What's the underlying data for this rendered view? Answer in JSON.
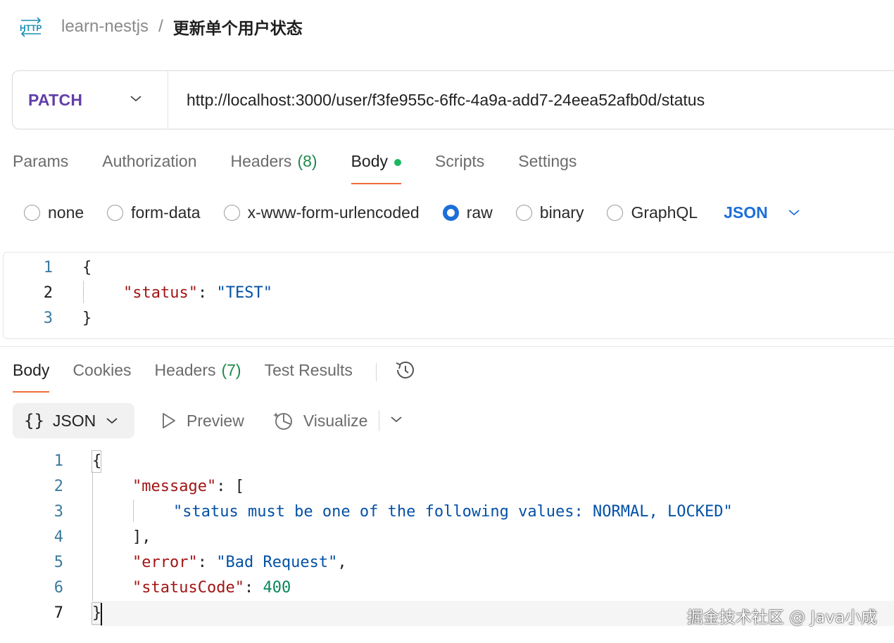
{
  "header": {
    "icon": "http-icon",
    "collection": "learn-nestjs",
    "separator": "/",
    "request_name": "更新单个用户状态"
  },
  "request": {
    "method": "PATCH",
    "url": "http://localhost:3000/user/f3fe955c-6ffc-4a9a-add7-24eea52afb0d/status"
  },
  "request_tabs": [
    {
      "label": "Params",
      "count": "",
      "active": false
    },
    {
      "label": "Authorization",
      "count": "",
      "active": false
    },
    {
      "label": "Headers",
      "count": "(8)",
      "active": false
    },
    {
      "label": "Body",
      "count": "",
      "active": true
    },
    {
      "label": "Scripts",
      "count": "",
      "active": false
    },
    {
      "label": "Settings",
      "count": "",
      "active": false
    }
  ],
  "body_types": {
    "options": [
      "none",
      "form-data",
      "x-www-form-urlencoded",
      "raw",
      "binary",
      "GraphQL"
    ],
    "selected": "raw",
    "format": "JSON"
  },
  "request_body": {
    "line_numbers": [
      "1",
      "2",
      "3"
    ],
    "open": "{",
    "key": "\"status\"",
    "colon": ": ",
    "value": "\"TEST\"",
    "close": "}"
  },
  "response_tabs": {
    "body": "Body",
    "cookies": "Cookies",
    "headers": "Headers",
    "headers_count": "(7)",
    "test_results": "Test Results"
  },
  "response_toolbar": {
    "format": "JSON",
    "preview": "Preview",
    "visualize": "Visualize"
  },
  "response_body": {
    "line_numbers": [
      "1",
      "2",
      "3",
      "4",
      "5",
      "6",
      "7"
    ],
    "open": "{",
    "message_key": "\"message\"",
    "colon": ": ",
    "open_bracket": "[",
    "message_value": "\"status must be one of the following values: NORMAL, LOCKED\"",
    "close_bracket": "],",
    "error_key": "\"error\"",
    "error_value": "\"Bad Request\"",
    "comma": ",",
    "status_key": "\"statusCode\"",
    "status_value": "400",
    "close": "}"
  },
  "watermark": "掘金技术社区 @ Java小成",
  "colors": {
    "method": "#623ea8",
    "accent_tab": "#ef6c3b",
    "body_dot": "#1cb861",
    "radio_selected": "#1d6fd8",
    "json_key": "#a31515",
    "json_string": "#0451a5",
    "json_number": "#098658"
  }
}
